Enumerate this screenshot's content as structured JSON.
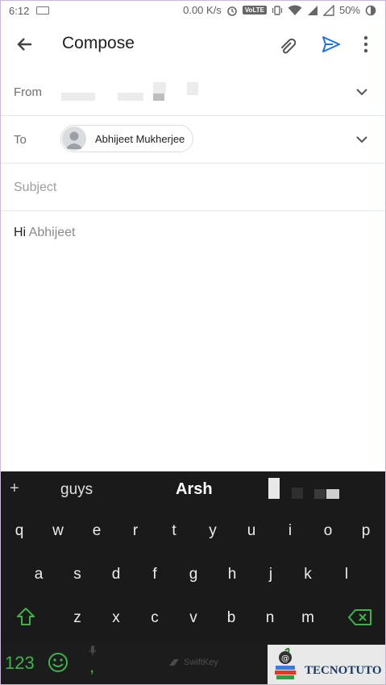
{
  "status_bar": {
    "time": "6:12",
    "speed": "0.00 K/s",
    "volte": "VoLTE",
    "battery": "50%"
  },
  "app_bar": {
    "title": "Compose",
    "icons": [
      "back-arrow-icon",
      "attachment-icon",
      "send-icon",
      "more-vert-icon"
    ]
  },
  "from": {
    "label": "From"
  },
  "to": {
    "label": "To",
    "recipient": "Abhijeet Mukherjee"
  },
  "subject": {
    "placeholder": "Subject"
  },
  "body": {
    "greeting": "Hi",
    "name": "Abhijeet"
  },
  "keyboard": {
    "suggestions": [
      "guys",
      "Arsh"
    ],
    "row1": [
      "q",
      "w",
      "e",
      "r",
      "t",
      "y",
      "u",
      "i",
      "o",
      "p"
    ],
    "row2": [
      "a",
      "s",
      "d",
      "f",
      "g",
      "h",
      "j",
      "k",
      "l"
    ],
    "row3": [
      "z",
      "x",
      "c",
      "v",
      "b",
      "n",
      "m"
    ],
    "numbers_key": "123",
    "comma_key": ",",
    "brand": "SwiftKey",
    "accent_color": "#3bb54a"
  },
  "watermark": {
    "text": "TECNOTUTO"
  }
}
